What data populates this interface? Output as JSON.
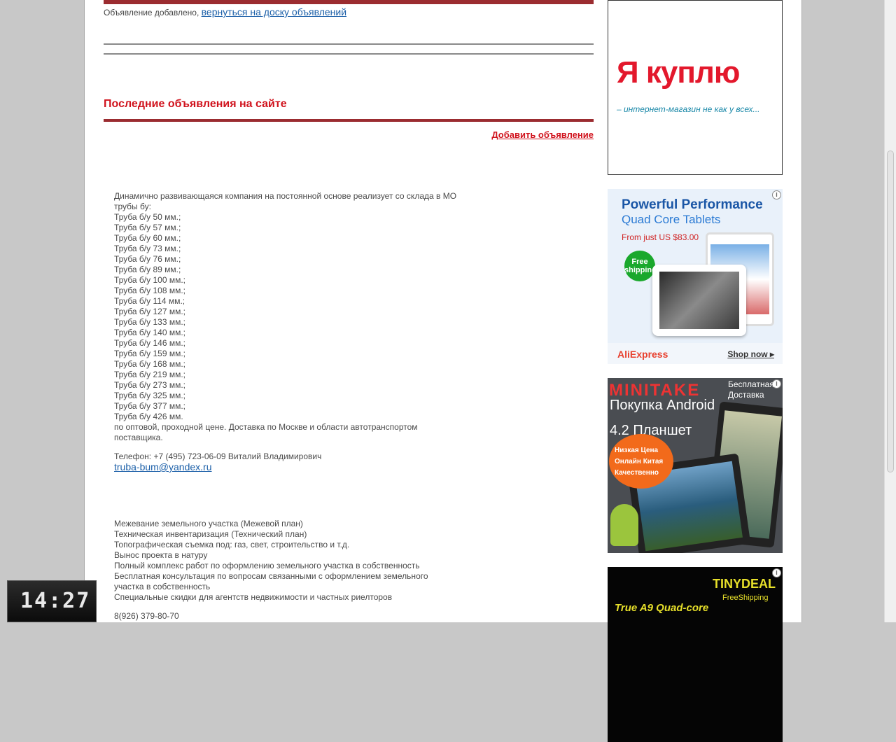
{
  "main": {
    "notice_text": "Объявление добавлено,",
    "notice_link": "вернуться на доску объявлений",
    "section_title": "Последние объявления на сайте",
    "add_ad_link": "Добавить объявление",
    "listing1": {
      "lines": [
        "Динамично развивающаяся компания на постоянной основе реализует со склада в МО",
        "трубы бу:",
        "Труба б/у 50 мм.;",
        "Труба б/у 57 мм.;",
        "Труба б/у 60 мм.;",
        "Труба б/у 73 мм.;",
        "Труба б/у 76 мм.;",
        "Труба б/у 89 мм.;",
        "Труба б/у 100 мм.;",
        "Труба б/у 108 мм.;",
        "Труба б/у 114 мм.;",
        "Труба б/у 127 мм.;",
        "Труба б/у 133 мм.;",
        "Труба б/у 140 мм.;",
        "Труба б/у 146 мм.;",
        "Труба б/у 159 мм.;",
        "Труба б/у 168 мм.;",
        "Труба б/у 219 мм.;",
        "Труба б/у 273 мм.;",
        "Труба б/у 325 мм.;",
        "Труба б/у 377 мм.;",
        "Труба б/у 426 мм.",
        "по оптовой, проходной цене. Доставка по Москве и области автотранспортом",
        "поставщика."
      ],
      "phone": "Телефон: +7 (495) 723-06-09 Виталий Владимирович",
      "email": "truba-bum@yandex.ru"
    },
    "listing2": {
      "lines": [
        "Межевание земельного участка (Межевой план)",
        "Техническая инвентаризация (Технический план)",
        "Топографическая съемка под: газ, свет, строительство и т.д.",
        "Вынос проекта в натуру",
        "Полный комплекс работ по оформлению земельного участка в собственность",
        "Бесплатная консультация по вопросам связанными с оформлением земельного",
        "участка в собственность",
        "Специальные скидки для агентств недвижимости и частных риелторов"
      ],
      "phone": "8(926) 379-80-70"
    }
  },
  "sidebar": {
    "ad1": {
      "logo": "Я куплю",
      "slogan": "– интернет-магазин не как у всех..."
    },
    "ad2": {
      "headline": "Powerful Performance",
      "subheadline": "Quad Core Tablets",
      "price": "From just US $83.00",
      "badge": "Free shipping",
      "brand": "AliExpress",
      "cta": "Shop now ▸"
    },
    "ad3": {
      "brand": "MINITAKE",
      "free_delivery": "Бесплатная Доставка",
      "title_line1": "Покупка Android",
      "title_line2": "4.2 Планшет",
      "burst_lines": [
        "Низкая Цена",
        "Онлайн Китая",
        "Качественно"
      ]
    },
    "ad4": {
      "brand": "TINYDEAL",
      "shipping": "FreeShipping",
      "text": "True A9 Quad-core"
    },
    "info_glyph": "i"
  },
  "clock": {
    "time": "14:27"
  },
  "colors": {
    "accent_red": "#d0121c",
    "bar_dark_red": "#9b2c30",
    "link_blue": "#1b5fa8"
  }
}
